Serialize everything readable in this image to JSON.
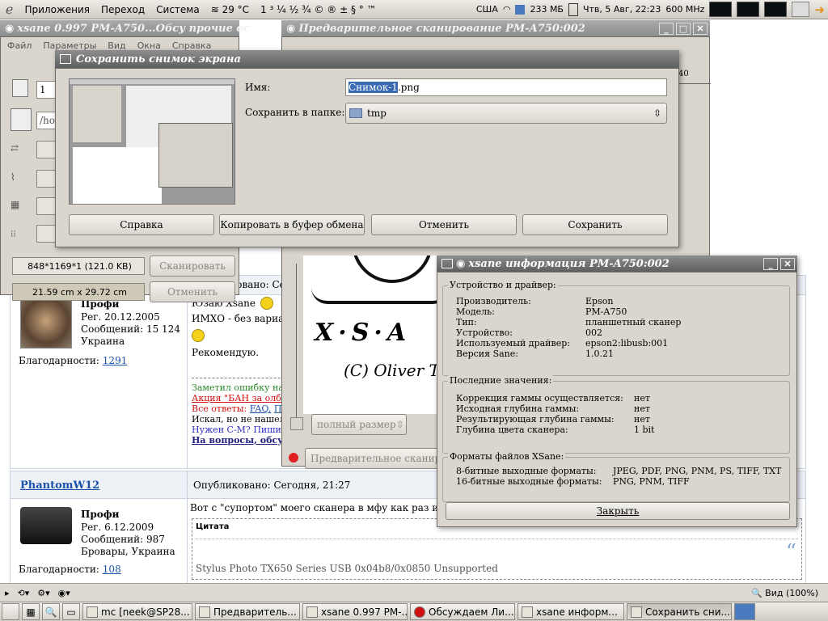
{
  "top_panel": {
    "menu": [
      "Приложения",
      "Переход",
      "Система"
    ],
    "weather": "29 °C",
    "chars": "1 ³ ¼ ½ ¾ © ® ± § ° ™",
    "lang": "США",
    "mem": "233 МБ",
    "datetime": "Чтв, 5 Авг, 22:23",
    "cpu": "600 MHz"
  },
  "xsane_main": {
    "title": "xsane 0.997 PM-A750...Обсу прочие ос",
    "menu": [
      "Файл",
      "Параметры",
      "Вид",
      "Окна",
      "Справка"
    ],
    "page_field": "1",
    "path_field": "/ho",
    "size_text": "848*1169*1 (121.0 KB)",
    "dims_text": "21.59 cm x 29.72 cm",
    "scan_btn": "Сканировать",
    "cancel_btn": "Отменить"
  },
  "preview": {
    "title": "Предварительное сканирование PM-A750:002",
    "ruler_mark": "40",
    "zoom_select": "полный размер",
    "scan_btn": "Предварительное сканиров",
    "logo_text": "X·S·A",
    "credit": "(C) Oliver T"
  },
  "save_dialog": {
    "title": "Сохранить снимок экрана",
    "name_label": "Имя:",
    "name_value_sel": "Снимок-1",
    "name_value_rest": ".png",
    "folder_label": "Сохранить в папке:",
    "folder_value": "tmp",
    "help_btn": "Справка",
    "copy_btn": "Копировать в буфер обмена",
    "cancel_btn": "Отменить",
    "save_btn": "Сохранить"
  },
  "info": {
    "title": "xsane информация PM-A750:002",
    "g1_title": "Устройство и драйвер:",
    "g1": [
      [
        "Производитель:",
        "Epson"
      ],
      [
        "Модель:",
        "PM-A750"
      ],
      [
        "Тип:",
        "планшетный сканер"
      ],
      [
        "Устройство:",
        "002"
      ],
      [
        "Используемый драйвер:",
        "epson2:libusb:001"
      ],
      [
        "Версия Sane:",
        "1.0.21"
      ]
    ],
    "g2_title": "Последние значения:",
    "g2": [
      [
        "Коррекция гаммы осуществляется:",
        "нет"
      ],
      [
        "Исходная глубина гаммы:",
        "нет"
      ],
      [
        "Результирующая глубина гаммы:",
        "нет"
      ],
      [
        "Глубина цвета сканера:",
        "1 bit"
      ]
    ],
    "g3_title": "Форматы файлов XSane:",
    "g3": [
      [
        "8-битные выходные форматы:",
        "JPEG, PDF, PNG, PNM, PS, TIFF, TXT"
      ],
      [
        "16-битные выходные форматы:",
        "PNG, PNM, TIFF"
      ]
    ],
    "close_btn": "Закрыть"
  },
  "forum": {
    "post1": {
      "rank": "Профи",
      "reg": "Рег. 20.12.2005",
      "msgs": "Сообщений: 15 124",
      "loc": "Украина",
      "thanks_label": "Благодарности:",
      "thanks": "1291",
      "published": "Опубликовано: Сегодн",
      "text1": "Юзаю Xsane",
      "text2": "ИМХО - без вариан",
      "text3": "Рекомендую.",
      "sig1": "Заметил ошибку на",
      "sig2": "Акция \"БАН за олба",
      "sig3a": "Все ответы:",
      "sig3b": "FAQ,",
      "sig3c": "По",
      "sig4": "Искал, но не нашел",
      "sig5": "Нужен С-М? Пиши в",
      "sig6": "На вопросы, обсуж"
    },
    "post2": {
      "user": "PhantomW12",
      "published": "Опубликовано: Сегодня, 21:27",
      "rank": "Профи",
      "reg": "Рег. 6.12.2009",
      "msgs": "Сообщений: 987",
      "loc": "Бровары, Украина",
      "thanks_label": "Благодарности:",
      "thanks": "108",
      "text": "Вот с \"супортом\" моего сканера в мфу как раз и п",
      "quote_label": "Цитата",
      "quote": "Stylus Photo TX650 Series USB 0x04b8/0x0850 Unsupported"
    },
    "zoom": "Вид (100%)"
  },
  "taskbar": [
    "mc [neek@SP28...",
    "Предваритель...",
    "xsane 0.997 PM-...",
    "Обсуждаем Ли...",
    "xsane информ...",
    "Сохранить сни..."
  ]
}
